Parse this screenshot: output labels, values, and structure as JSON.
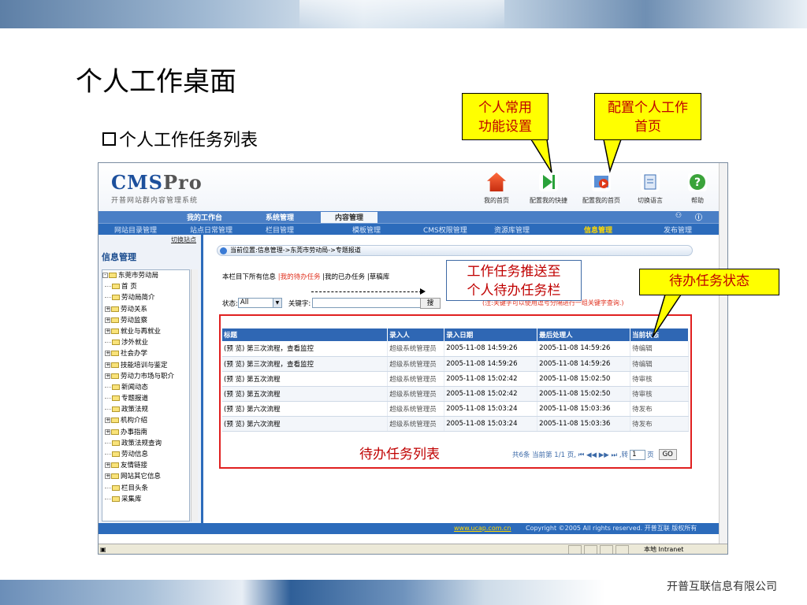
{
  "slide": {
    "title": "个人工作桌面",
    "subtitle": "个人工作任务列表",
    "company": "开普互联信息有限公司"
  },
  "callouts": {
    "shortcut": "个人常用功能设置",
    "homepage": "配置个人工作首页",
    "push": "工作任务推送至个人待办任务栏",
    "status": "待办任务状态",
    "todo_list": "待办任务列表"
  },
  "colors": {
    "callout_text": "#c00000",
    "callout_fill": "#ffff00",
    "nav": "#2c6bbb",
    "highlight_box": "#e02020"
  },
  "app": {
    "logo": "CMS",
    "logo_suffix": "Pro",
    "logo_sub": "开普网站群内容管理系统",
    "toolbar": [
      {
        "icon": "home-icon",
        "label": "我的首页"
      },
      {
        "icon": "shortcut-icon",
        "label": "配置我的快捷"
      },
      {
        "icon": "config-home-icon",
        "label": "配置我的首页"
      },
      {
        "icon": "language-icon",
        "label": "切换语言"
      },
      {
        "icon": "help-icon",
        "label": "帮助"
      }
    ],
    "nav1": [
      "我的工作台",
      "系统管理",
      "内容管理"
    ],
    "nav2": [
      "网站目录管理",
      "站点日常管理",
      "栏目管理",
      "模板管理",
      "CMS权限管理",
      "资源库管理",
      "信息管理",
      "发布管理"
    ],
    "switch_site": "切换站点",
    "sidebar_title": "信息管理",
    "tree": [
      {
        "label": "东莞市劳动局",
        "exp": "-"
      },
      {
        "label": "首 页",
        "exp": ""
      },
      {
        "label": "劳动局简介",
        "exp": ""
      },
      {
        "label": "劳动关系",
        "exp": "+"
      },
      {
        "label": "劳动监察",
        "exp": "+"
      },
      {
        "label": "就业与再就业",
        "exp": "+"
      },
      {
        "label": "涉外就业",
        "exp": ""
      },
      {
        "label": "社会办学",
        "exp": "+"
      },
      {
        "label": "技能培训与鉴定",
        "exp": "+"
      },
      {
        "label": "劳动力市场与职介",
        "exp": "+"
      },
      {
        "label": "新闻动态",
        "exp": ""
      },
      {
        "label": "专题报道",
        "exp": ""
      },
      {
        "label": "政策法规",
        "exp": ""
      },
      {
        "label": "机构介绍",
        "exp": "+"
      },
      {
        "label": "办事指南",
        "exp": "+"
      },
      {
        "label": "政策法规查询",
        "exp": ""
      },
      {
        "label": "劳动信息",
        "exp": ""
      },
      {
        "label": "友情链接",
        "exp": "+"
      },
      {
        "label": "网站其它信息",
        "exp": "+"
      },
      {
        "label": "栏目头条",
        "exp": ""
      },
      {
        "label": "采集库",
        "exp": ""
      }
    ],
    "breadcrumb": "当前位置:信息管理->东莞市劳动局->专题报道",
    "tabs": {
      "all": "本栏目下所有信息",
      "mine": "|我的待办任务",
      "done": "|我的已办任务",
      "draft": "|草稿库"
    },
    "filter": {
      "status_label": "状态:",
      "status_value": "All",
      "keyword_label": "关键字:",
      "search": "搜",
      "hint": "(注:关键字可以使用逗号分隔进行一组关键字查询.)"
    },
    "table": {
      "headers": [
        "标题",
        "录入人",
        "录入日期",
        "最后处理人",
        "当前状态"
      ],
      "rows": [
        [
          "(预 览) 第三次流程，查看监控",
          "超级系统管理员",
          "2005-11-08 14:59:26",
          "2005-11-08 14:59:26",
          "待编辑"
        ],
        [
          "(预 览) 第三次流程，查看监控",
          "超级系统管理员",
          "2005-11-08 14:59:26",
          "2005-11-08 14:59:26",
          "待编辑"
        ],
        [
          "(预 览) 第五次流程",
          "超级系统管理员",
          "2005-11-08 15:02:42",
          "2005-11-08 15:02:50",
          "待审核"
        ],
        [
          "(预 览) 第五次流程",
          "超级系统管理员",
          "2005-11-08 15:02:42",
          "2005-11-08 15:02:50",
          "待审核"
        ],
        [
          "(预 览) 第六次流程",
          "超级系统管理员",
          "2005-11-08 15:03:24",
          "2005-11-08 15:03:36",
          "待发布"
        ],
        [
          "(预 览) 第六次流程",
          "超级系统管理员",
          "2005-11-08 15:03:24",
          "2005-11-08 15:03:36",
          "待发布"
        ]
      ]
    },
    "pager": {
      "text": "共6条 当前第 1/1 页, ⏮ ◀◀ ▶▶ ⏭ ,转",
      "page": "1",
      "unit": "页",
      "go": "GO"
    },
    "footer": {
      "url": "www.ucap.com.cn",
      "copyright": "Copyright ©2005 All rights reserved. 开普互联 版权所有"
    },
    "status_bar": "本地 Intranet"
  }
}
